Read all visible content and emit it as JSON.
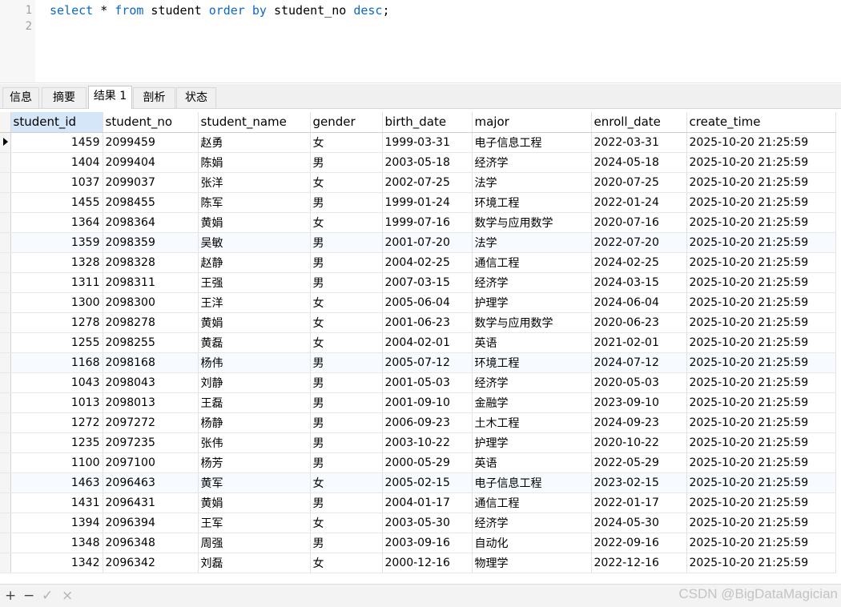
{
  "editor": {
    "lines": [
      {
        "number": "1",
        "tokens": [
          {
            "text": "select",
            "kw": true
          },
          {
            "text": " * ",
            "kw": false
          },
          {
            "text": "from",
            "kw": true
          },
          {
            "text": " student ",
            "kw": false
          },
          {
            "text": "order",
            "kw": true
          },
          {
            "text": " ",
            "kw": false
          },
          {
            "text": "by",
            "kw": true
          },
          {
            "text": " student_no ",
            "kw": false
          },
          {
            "text": "desc",
            "kw": true
          },
          {
            "text": ";",
            "kw": false
          }
        ]
      },
      {
        "number": "2",
        "tokens": []
      }
    ]
  },
  "tabs": [
    {
      "label": "信息",
      "active": false
    },
    {
      "label": "摘要",
      "active": false
    },
    {
      "label": "结果 1",
      "active": true
    },
    {
      "label": "剖析",
      "active": false
    },
    {
      "label": "状态",
      "active": false
    }
  ],
  "grid": {
    "columns": [
      "student_id",
      "student_no",
      "student_name",
      "gender",
      "birth_date",
      "major",
      "enroll_date",
      "create_time"
    ],
    "rows": [
      [
        "1459",
        "2099459",
        "赵勇",
        "女",
        "1999-03-31",
        "电子信息工程",
        "2022-03-31",
        "2025-10-20 21:25:59"
      ],
      [
        "1404",
        "2099404",
        "陈娟",
        "男",
        "2003-05-18",
        "经济学",
        "2024-05-18",
        "2025-10-20 21:25:59"
      ],
      [
        "1037",
        "2099037",
        "张洋",
        "女",
        "2002-07-25",
        "法学",
        "2020-07-25",
        "2025-10-20 21:25:59"
      ],
      [
        "1455",
        "2098455",
        "陈军",
        "男",
        "1999-01-24",
        "环境工程",
        "2022-01-24",
        "2025-10-20 21:25:59"
      ],
      [
        "1364",
        "2098364",
        "黄娟",
        "女",
        "1999-07-16",
        "数学与应用数学",
        "2020-07-16",
        "2025-10-20 21:25:59"
      ],
      [
        "1359",
        "2098359",
        "吴敏",
        "男",
        "2001-07-20",
        "法学",
        "2022-07-20",
        "2025-10-20 21:25:59"
      ],
      [
        "1328",
        "2098328",
        "赵静",
        "男",
        "2004-02-25",
        "通信工程",
        "2024-02-25",
        "2025-10-20 21:25:59"
      ],
      [
        "1311",
        "2098311",
        "王强",
        "男",
        "2007-03-15",
        "经济学",
        "2024-03-15",
        "2025-10-20 21:25:59"
      ],
      [
        "1300",
        "2098300",
        "王洋",
        "女",
        "2005-06-04",
        "护理学",
        "2024-06-04",
        "2025-10-20 21:25:59"
      ],
      [
        "1278",
        "2098278",
        "黄娟",
        "女",
        "2001-06-23",
        "数学与应用数学",
        "2020-06-23",
        "2025-10-20 21:25:59"
      ],
      [
        "1255",
        "2098255",
        "黄磊",
        "女",
        "2004-02-01",
        "英语",
        "2021-02-01",
        "2025-10-20 21:25:59"
      ],
      [
        "1168",
        "2098168",
        "杨伟",
        "男",
        "2005-07-12",
        "环境工程",
        "2024-07-12",
        "2025-10-20 21:25:59"
      ],
      [
        "1043",
        "2098043",
        "刘静",
        "男",
        "2001-05-03",
        "经济学",
        "2020-05-03",
        "2025-10-20 21:25:59"
      ],
      [
        "1013",
        "2098013",
        "王磊",
        "男",
        "2001-09-10",
        "金融学",
        "2023-09-10",
        "2025-10-20 21:25:59"
      ],
      [
        "1272",
        "2097272",
        "杨静",
        "男",
        "2006-09-23",
        "土木工程",
        "2024-09-23",
        "2025-10-20 21:25:59"
      ],
      [
        "1235",
        "2097235",
        "张伟",
        "男",
        "2003-10-22",
        "护理学",
        "2020-10-22",
        "2025-10-20 21:25:59"
      ],
      [
        "1100",
        "2097100",
        "杨芳",
        "男",
        "2000-05-29",
        "英语",
        "2022-05-29",
        "2025-10-20 21:25:59"
      ],
      [
        "1463",
        "2096463",
        "黄军",
        "女",
        "2005-02-15",
        "电子信息工程",
        "2023-02-15",
        "2025-10-20 21:25:59"
      ],
      [
        "1431",
        "2096431",
        "黄娟",
        "男",
        "2004-01-17",
        "通信工程",
        "2022-01-17",
        "2025-10-20 21:25:59"
      ],
      [
        "1394",
        "2096394",
        "王军",
        "女",
        "2003-05-30",
        "经济学",
        "2024-05-30",
        "2025-10-20 21:25:59"
      ],
      [
        "1348",
        "2096348",
        "周强",
        "男",
        "2003-09-16",
        "自动化",
        "2022-09-16",
        "2025-10-20 21:25:59"
      ],
      [
        "1342",
        "2096342",
        "刘磊",
        "女",
        "2000-12-16",
        "物理学",
        "2022-12-16",
        "2025-10-20 21:25:59"
      ]
    ]
  },
  "bottombar": {
    "add": "+",
    "remove": "−",
    "apply": "✓",
    "cancel": "×"
  },
  "watermark": "CSDN @BigDataMagician"
}
